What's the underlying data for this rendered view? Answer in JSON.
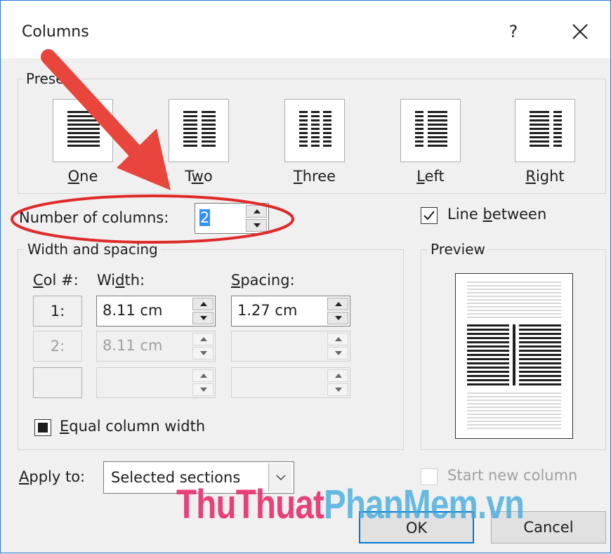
{
  "window": {
    "title": "Columns",
    "help_label": "?"
  },
  "presets": {
    "legend": "Presets",
    "items": [
      {
        "label_u": "O",
        "label_rest": "ne"
      },
      {
        "label_pre": "T",
        "label_u": "w",
        "label_rest": "o"
      },
      {
        "label_u": "T",
        "label_rest": "hree"
      },
      {
        "label_u": "L",
        "label_rest": "eft"
      },
      {
        "label_u": "R",
        "label_rest": "ight"
      }
    ]
  },
  "number_of_columns": {
    "label": "Number of columns:",
    "value": "2"
  },
  "line_between": {
    "label_pre": "Line ",
    "label_u": "b",
    "label_rest": "etween",
    "checked": true
  },
  "width_spacing": {
    "legend": "Width and spacing",
    "col_header_u": "C",
    "col_header_rest": "ol #:",
    "width_header_pre": "Wi",
    "width_header_u": "d",
    "width_header_rest": "th:",
    "spacing_header_u": "S",
    "spacing_header_rest": "pacing:",
    "rows": [
      {
        "col": "1:",
        "width": "8.11 cm",
        "spacing": "1.27 cm"
      },
      {
        "col": "2:",
        "width": "8.11 cm",
        "spacing": ""
      },
      {
        "col": "",
        "width": "",
        "spacing": ""
      }
    ],
    "equal_width": {
      "label_u": "E",
      "label_rest": "qual column width",
      "state": "indeterminate"
    }
  },
  "preview": {
    "legend": "Preview"
  },
  "apply_to": {
    "label_u": "A",
    "label_rest": "pply to:",
    "value": "Selected sections"
  },
  "start_new_column": {
    "label": "Start new column",
    "checked": false
  },
  "buttons": {
    "ok": "OK",
    "cancel": "Cancel"
  },
  "watermark": {
    "part1": "ThuThuat",
    "part2": "PhanMem.vn"
  },
  "colors": {
    "annotation_red": "#e8463c",
    "accent": "#0078d7"
  }
}
